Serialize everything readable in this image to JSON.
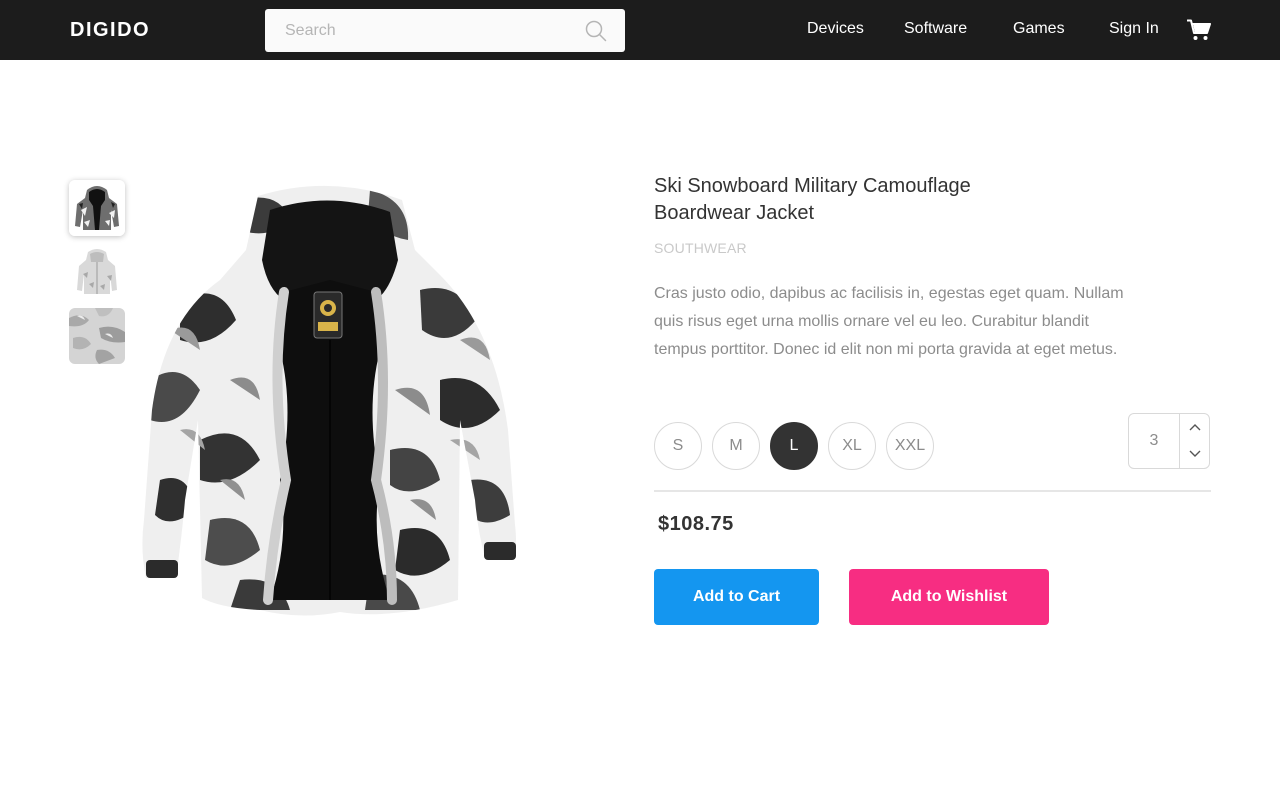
{
  "header": {
    "logo": "DIGIDO",
    "search_placeholder": "Search",
    "nav": [
      "Devices",
      "Software",
      "Games"
    ],
    "sign_in": "Sign In",
    "icons": {
      "search": "search-icon",
      "cart": "cart-icon"
    }
  },
  "product": {
    "title": "Ski Snowboard Military Camouflage Boardwear Jacket",
    "brand": "SOUTHWEAR",
    "description": "Cras justo odio, dapibus ac facilisis in, egestas eget quam. Nullam quis risus eget urna mollis ornare vel eu leo. Curabitur blandit tempus porttitor. Donec id elit non mi porta gravida at eget metus.",
    "sizes": [
      "S",
      "M",
      "L",
      "XL",
      "XXL"
    ],
    "selected_size": "L",
    "quantity": "3",
    "price": "$108.75",
    "thumbnails": [
      "jacket-front",
      "jacket-white",
      "camo-fabric"
    ],
    "selected_thumbnail": 0
  },
  "actions": {
    "add_to_cart": "Add to Cart",
    "add_to_wishlist": "Add to Wishlist"
  },
  "colors": {
    "topbar": "#1c1c1c",
    "cart_button": "#1496f0",
    "wishlist_button": "#f72d82",
    "selected_size": "#333333"
  }
}
